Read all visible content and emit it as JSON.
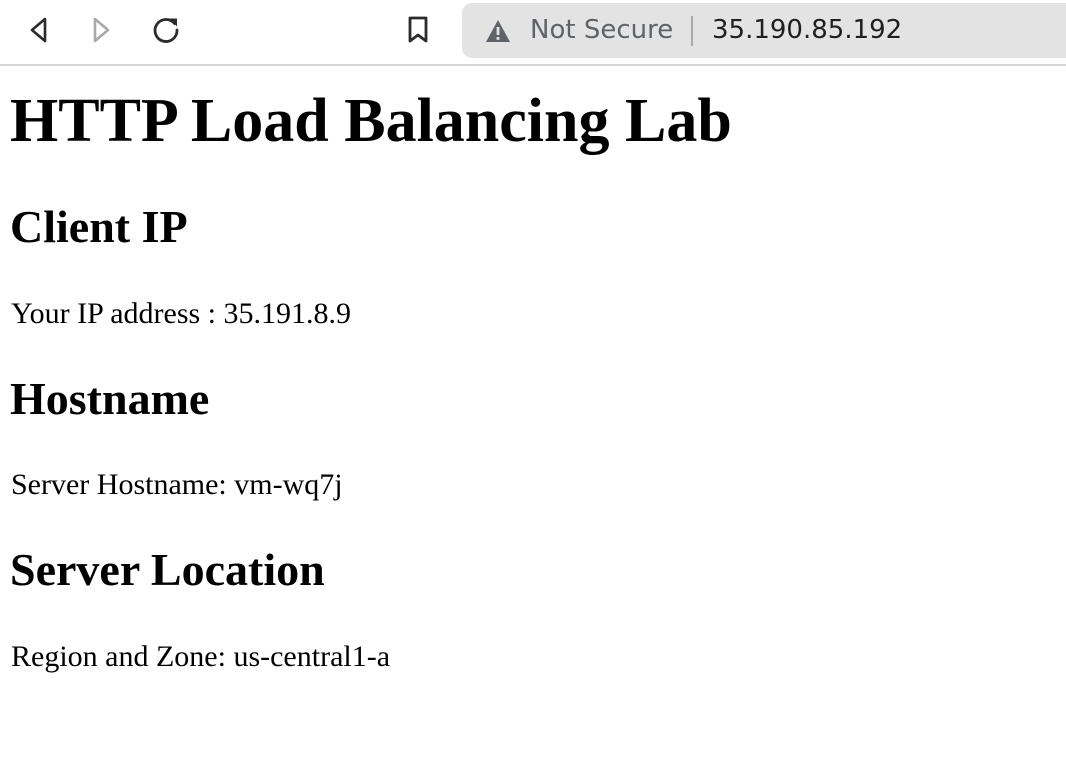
{
  "browser": {
    "toolbar_icons": {
      "back": "chevron-left-icon",
      "forward": "chevron-right-icon",
      "reload": "reload-icon",
      "bookmark": "bookmark-icon",
      "warning": "warning-triangle-icon"
    },
    "security_label": "Not Secure",
    "url": "35.190.85.192",
    "colors": {
      "address_bar_bg": "#e3e3e3",
      "security_text": "#5f6368"
    }
  },
  "page": {
    "title": "HTTP Load Balancing Lab",
    "sections": [
      {
        "heading": "Client IP",
        "text": "Your IP address : 35.191.8.9"
      },
      {
        "heading": "Hostname",
        "text": "Server Hostname: vm-wq7j"
      },
      {
        "heading": "Server Location",
        "text": "Region and Zone: us-central1-a"
      }
    ]
  }
}
